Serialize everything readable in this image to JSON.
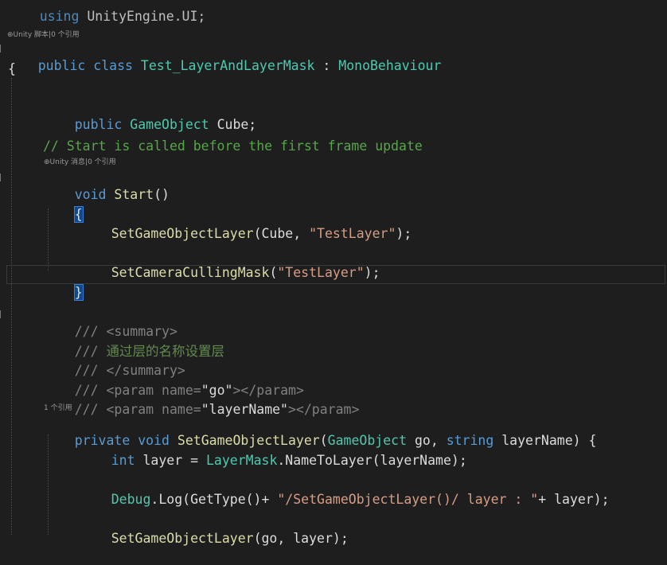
{
  "editor": {
    "top_fragment": {
      "kw": "using",
      "rest": " UnityEngine.UI;"
    },
    "lens_class": "⊕Unity 脚本|0 个引用",
    "class_line": {
      "kw1": "public",
      "kw2": "class",
      "name": "Test_LayerAndLayerMask",
      "colon": " : ",
      "base": "MonoBehaviour"
    },
    "open_brace": "{",
    "field_line": {
      "kw": "public",
      "type": "GameObject",
      "rest": " Cube;"
    },
    "comment_start": "// Start is called before the first frame update",
    "lens_start": "⊕Unity 消息|0 个引用",
    "start_sig": {
      "kw": "void",
      "name": " Start",
      "rest": "()"
    },
    "start_open": "{",
    "call1": {
      "name": "SetGameObjectLayer",
      "args_pre": "(Cube, ",
      "str": "\"TestLayer\"",
      "args_post": ");"
    },
    "call2": {
      "name": "SetCameraCullingMask",
      "args_pre": "(",
      "str": "\"TestLayer\"",
      "args_post": ");"
    },
    "start_close": "}",
    "doc1": {
      "slashes": "/// ",
      "tag": "<summary>"
    },
    "doc2": {
      "slashes": "/// ",
      "text": "通过层的名称设置层"
    },
    "doc3": {
      "slashes": "/// ",
      "tag": "</summary>"
    },
    "doc4": {
      "slashes": "/// ",
      "open": "<param name=",
      "val": "\"go\"",
      "close": "></param>"
    },
    "doc5": {
      "slashes": "/// ",
      "open": "<param name=",
      "val": "\"layerName\"",
      "close": "></param>"
    },
    "lens_method": "1 个引用",
    "method_sig": {
      "kw1": "private",
      "kw2": "void",
      "name": "SetGameObjectLayer",
      "p1t": "GameObject",
      "p1": " go, ",
      "p2t": "string",
      "p2": " layerName) {"
    },
    "layer_line": {
      "kw": "int",
      "rest1": " layer = ",
      "type": "LayerMask",
      "rest2": ".NameToLayer(layerName);"
    },
    "debug_line": {
      "type": "Debug",
      "rest1": ".Log(GetType()+ ",
      "str": "\"/SetGameObjectLayer()/ layer : \"",
      "rest2": "+ layer);"
    },
    "recur_line": {
      "name": "SetGameObjectLayer",
      "rest": "(go, layer);"
    }
  },
  "colors": {
    "background": "#1e1e1e",
    "keyword": "#569cd6",
    "type": "#4ec9b0",
    "string": "#d69d85",
    "comment": "#57a64a"
  }
}
